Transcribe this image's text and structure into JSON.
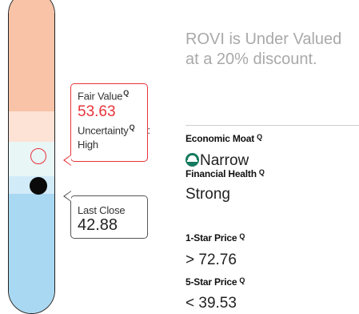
{
  "valuation": {
    "fair_value_label": "Fair Value",
    "fair_value": "53.63",
    "uncertainty_label": "Uncertainty",
    "uncertainty_colon": ":",
    "uncertainty_value": "High",
    "last_close_label": "Last Close",
    "last_close_value": "42.88",
    "q_icon": "Q"
  },
  "summary": "ROVI is Under Valued at a 20% discount.",
  "metrics": {
    "moat_label": "Economic Moat",
    "moat_value": "Narrow",
    "health_label": "Financial Health",
    "health_value": "Strong",
    "one_star_label": "1-Star Price",
    "one_star_value": "> 72.76",
    "five_star_label": "5-Star Price",
    "five_star_value": "< 39.53"
  },
  "colors": {
    "accent_red": "#e8333a",
    "moat_green": "#147a5e",
    "overvalued_band": "#f8c3a6",
    "undervalued_band": "#a9d8f2"
  },
  "icons": {
    "moat": "moat-icon",
    "help": "q-icon"
  }
}
